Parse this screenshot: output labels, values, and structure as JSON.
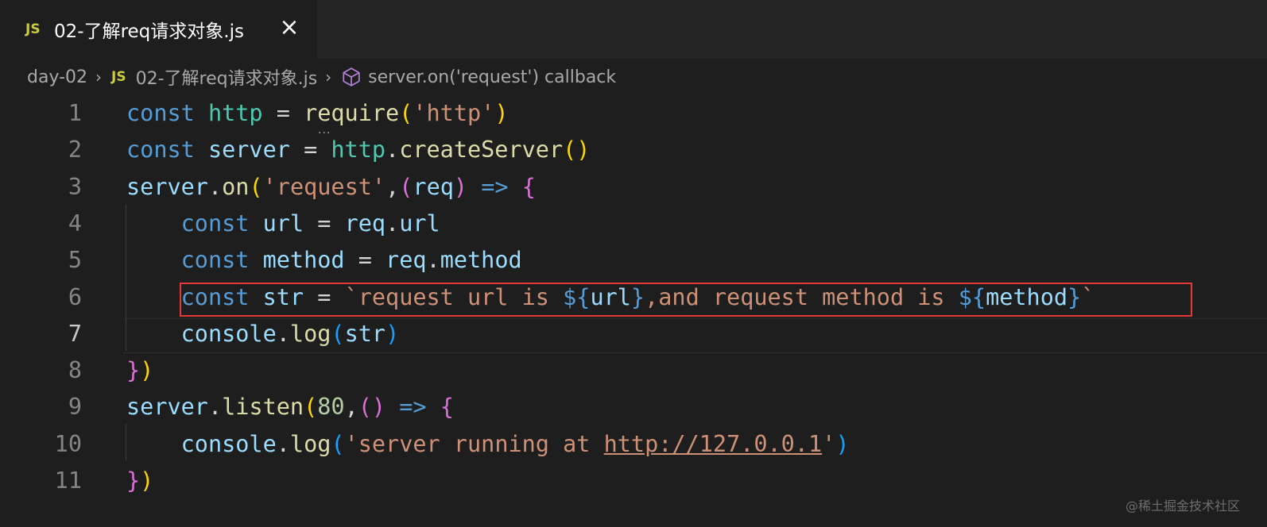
{
  "tab": {
    "badge": "JS",
    "title": "02-了解req请求对象.js",
    "close_icon": "×"
  },
  "breadcrumb": {
    "folder": "day-02",
    "sep": "›",
    "file_badge": "JS",
    "file": "02-了解req请求对象.js",
    "symbol": "server.on('request') callback"
  },
  "lines": [
    {
      "n": "1",
      "tokens": [
        [
          "kw",
          "const "
        ],
        [
          "cls",
          "http"
        ],
        [
          "op",
          " = "
        ],
        [
          "fn",
          "require"
        ],
        [
          "p1",
          "("
        ],
        [
          "str",
          "'http'"
        ],
        [
          "p1",
          ")"
        ]
      ]
    },
    {
      "n": "2",
      "tokens": [
        [
          "kw",
          "const "
        ],
        [
          "var",
          "server"
        ],
        [
          "op",
          " = "
        ],
        [
          "cls",
          "http"
        ],
        [
          "op",
          "."
        ],
        [
          "fn",
          "createServer"
        ],
        [
          "p1",
          "()"
        ]
      ]
    },
    {
      "n": "3",
      "tokens": [
        [
          "var",
          "server"
        ],
        [
          "op",
          "."
        ],
        [
          "fn",
          "on"
        ],
        [
          "p1",
          "("
        ],
        [
          "str",
          "'request'"
        ],
        [
          "op",
          ","
        ],
        [
          "p2",
          "("
        ],
        [
          "var",
          "req"
        ],
        [
          "p2",
          ")"
        ],
        [
          "op",
          " "
        ],
        [
          "kw",
          "=>"
        ],
        [
          "op",
          " "
        ],
        [
          "p2",
          "{"
        ]
      ]
    },
    {
      "n": "4",
      "tokens": [
        [
          "op",
          "    "
        ],
        [
          "kw",
          "const "
        ],
        [
          "var",
          "url"
        ],
        [
          "op",
          " = "
        ],
        [
          "var",
          "req"
        ],
        [
          "op",
          "."
        ],
        [
          "var",
          "url"
        ]
      ]
    },
    {
      "n": "5",
      "tokens": [
        [
          "op",
          "    "
        ],
        [
          "kw",
          "const "
        ],
        [
          "var",
          "method"
        ],
        [
          "op",
          " = "
        ],
        [
          "var",
          "req"
        ],
        [
          "op",
          "."
        ],
        [
          "var",
          "method"
        ]
      ]
    },
    {
      "n": "6",
      "tokens": [
        [
          "op",
          "    "
        ],
        [
          "kw",
          "const "
        ],
        [
          "var",
          "str"
        ],
        [
          "op",
          " = "
        ],
        [
          "str",
          "`request url is "
        ],
        [
          "kw",
          "${"
        ],
        [
          "var",
          "url"
        ],
        [
          "kw",
          "}"
        ],
        [
          "str",
          ",and request method is "
        ],
        [
          "kw",
          "${"
        ],
        [
          "var",
          "method"
        ],
        [
          "kw",
          "}"
        ],
        [
          "str",
          "`"
        ]
      ]
    },
    {
      "n": "7",
      "tokens": [
        [
          "op",
          "    "
        ],
        [
          "var",
          "console"
        ],
        [
          "op",
          "."
        ],
        [
          "fn",
          "log"
        ],
        [
          "p3",
          "("
        ],
        [
          "var",
          "str"
        ],
        [
          "p3",
          ")"
        ]
      ]
    },
    {
      "n": "8",
      "tokens": [
        [
          "p2",
          "}"
        ],
        [
          "p1",
          ")"
        ]
      ]
    },
    {
      "n": "9",
      "tokens": [
        [
          "var",
          "server"
        ],
        [
          "op",
          "."
        ],
        [
          "fn",
          "listen"
        ],
        [
          "p1",
          "("
        ],
        [
          "num",
          "80"
        ],
        [
          "op",
          ","
        ],
        [
          "p2",
          "()"
        ],
        [
          "op",
          " "
        ],
        [
          "kw",
          "=>"
        ],
        [
          "op",
          " "
        ],
        [
          "p2",
          "{"
        ]
      ]
    },
    {
      "n": "10",
      "tokens": [
        [
          "op",
          "    "
        ],
        [
          "var",
          "console"
        ],
        [
          "op",
          "."
        ],
        [
          "fn",
          "log"
        ],
        [
          "p3",
          "("
        ],
        [
          "str",
          "'server running at "
        ],
        [
          "link",
          "http://127.0.0.1"
        ],
        [
          "str",
          "'"
        ],
        [
          "p3",
          ")"
        ]
      ]
    },
    {
      "n": "11",
      "tokens": [
        [
          "p2",
          "}"
        ],
        [
          "p1",
          ")"
        ]
      ]
    }
  ],
  "active_line": "7",
  "hint_dots": "...",
  "watermark": "@稀土掘金技术社区",
  "colors": {
    "background": "#1e1e1e",
    "highlight_box": "#e53935",
    "js_badge": "#cbcb41"
  }
}
